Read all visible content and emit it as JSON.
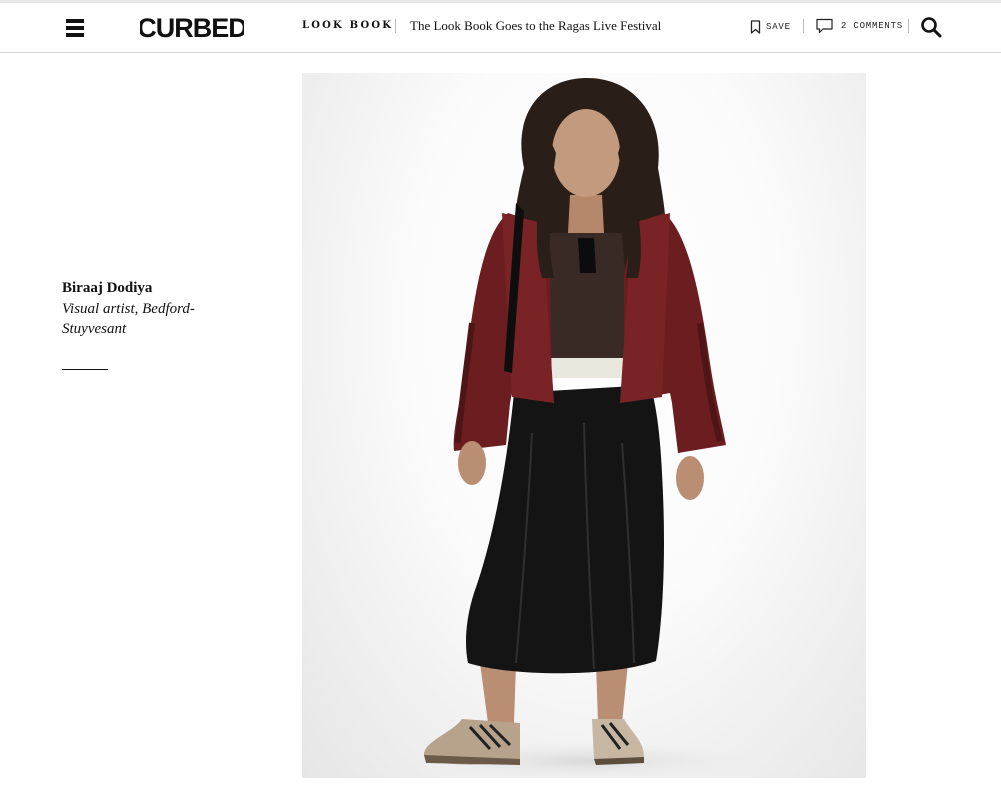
{
  "header": {
    "logo_text": "CURBED",
    "section": "LOOK BOOK",
    "headline": "The Look Book Goes to the Ragas Live Festival",
    "save_label": "SAVE",
    "comments_label": "2 COMMENTS"
  },
  "caption": {
    "name": "Biraaj Dodiya",
    "role": "Visual artist, Bedford-Stuyvesant"
  },
  "colors": {
    "jacket": "#6b1d1f",
    "top": "#3a2a26",
    "skirt": "#141414",
    "background": "#ffffff"
  },
  "icons": {
    "menu": "hamburger-menu-icon",
    "save": "bookmark-icon",
    "comments": "comment-bubble-icon",
    "search": "search-icon"
  }
}
